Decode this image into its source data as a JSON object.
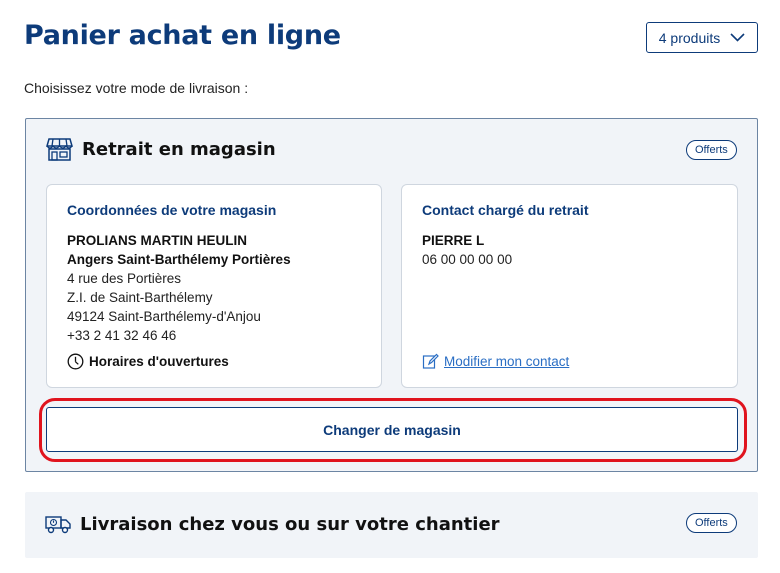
{
  "header": {
    "title": "Panier achat en ligne",
    "products_dropdown": "4 produits"
  },
  "prompt": "Choisissez votre mode de livraison :",
  "pickup": {
    "title": "Retrait en magasin",
    "badge": "Offerts",
    "store_card": {
      "title": "Coordonnées de votre magasin",
      "name": "PROLIANS MARTIN HEULIN",
      "branch": "Angers Saint-Barthélemy Portières",
      "address1": "4 rue des Portières",
      "address2": "Z.I. de Saint-Barthélemy",
      "address3": "49124 Saint-Barthélemy-d'Anjou",
      "phone": "+33 2 41 32 46 46",
      "hours_link": "Horaires d'ouvertures"
    },
    "contact_card": {
      "title": "Contact chargé du retrait",
      "name": "PIERRE L",
      "phone": "06 00 00 00 00",
      "edit_link": "Modifier mon contact"
    },
    "change_store_button": "Changer de magasin"
  },
  "delivery": {
    "title": "Livraison chez vous ou sur votre chantier",
    "badge": "Offerts"
  },
  "colors": {
    "brand": "#0d3b7a",
    "link": "#2a6ec4",
    "highlight": "#e0141e",
    "panel_bg": "#f1f4f8"
  },
  "icons": {
    "dropdown": "chevron-down-icon",
    "pickup": "storefront-icon",
    "hours": "clock-icon",
    "edit": "pencil-icon",
    "delivery": "delivery-truck-icon"
  }
}
